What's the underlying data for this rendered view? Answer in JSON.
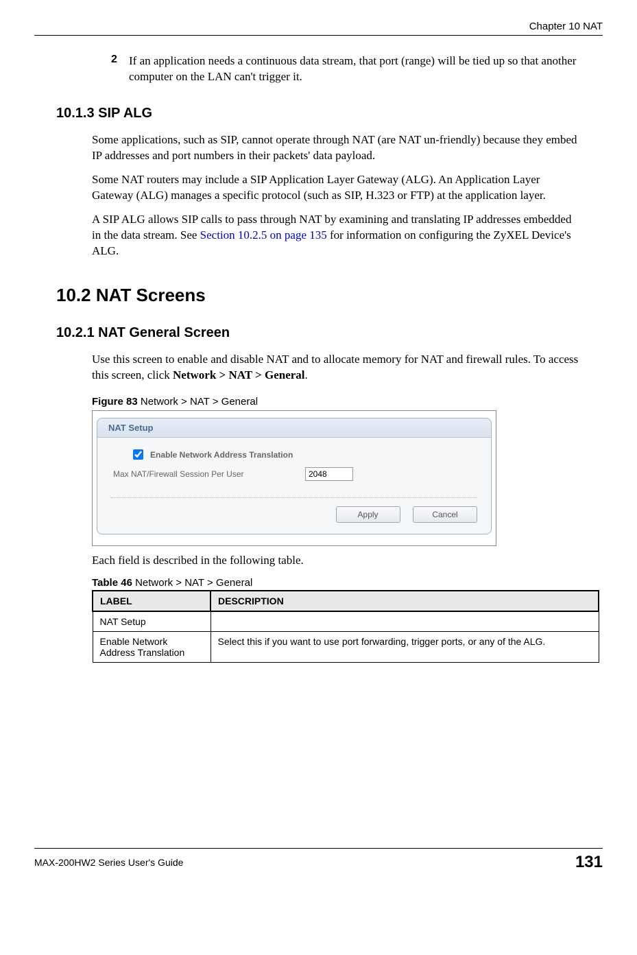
{
  "header": {
    "chapter": "Chapter 10 NAT"
  },
  "item2": {
    "num": "2",
    "text": "If an application needs a continuous data stream, that port (range) will be tied up so that another computer on the LAN can't trigger it."
  },
  "sec1013": {
    "heading": "10.1.3  SIP ALG",
    "p1": "Some applications, such as SIP, cannot operate through NAT (are NAT un-friendly) because they embed IP addresses and port numbers in their packets' data payload.",
    "p2": "Some NAT routers may include a SIP Application Layer Gateway (ALG). An Application Layer Gateway (ALG) manages a specific protocol (such as SIP, H.323 or FTP) at the application layer.",
    "p3a": "A SIP ALG allows SIP calls to pass through NAT by examining and translating IP addresses embedded in the data stream. See ",
    "p3link": "Section 10.2.5 on page 135",
    "p3b": " for information on configuring the ZyXEL Device's ALG."
  },
  "sec102": {
    "heading": "10.2  NAT Screens"
  },
  "sec1021": {
    "heading": "10.2.1  NAT General Screen",
    "p1a": "Use this screen to enable and disable NAT and to allocate memory for NAT and firewall rules. To access this screen, click ",
    "p1b": "Network > NAT > General",
    "p1c": "."
  },
  "figure": {
    "num": "Figure 83",
    "title": "   Network > NAT > General",
    "panelTitle": "NAT Setup",
    "chkLabel": "Enable Network Address Translation",
    "rowLabel": "Max NAT/Firewall Session Per User",
    "inputValue": "2048",
    "applyLabel": "Apply",
    "cancelLabel": "Cancel"
  },
  "afterFig": "Each field is described in the following table.",
  "table": {
    "num": "Table 46",
    "title": "   Network > NAT > General",
    "headers": {
      "label": "LABEL",
      "desc": "DESCRIPTION"
    },
    "rows": [
      {
        "label": "NAT Setup",
        "desc": ""
      },
      {
        "label": "Enable Network Address Translation",
        "desc": "Select this if you want to use port forwarding, trigger ports, or any of the ALG."
      }
    ]
  },
  "footer": {
    "left": "MAX-200HW2 Series User's Guide",
    "page": "131"
  }
}
